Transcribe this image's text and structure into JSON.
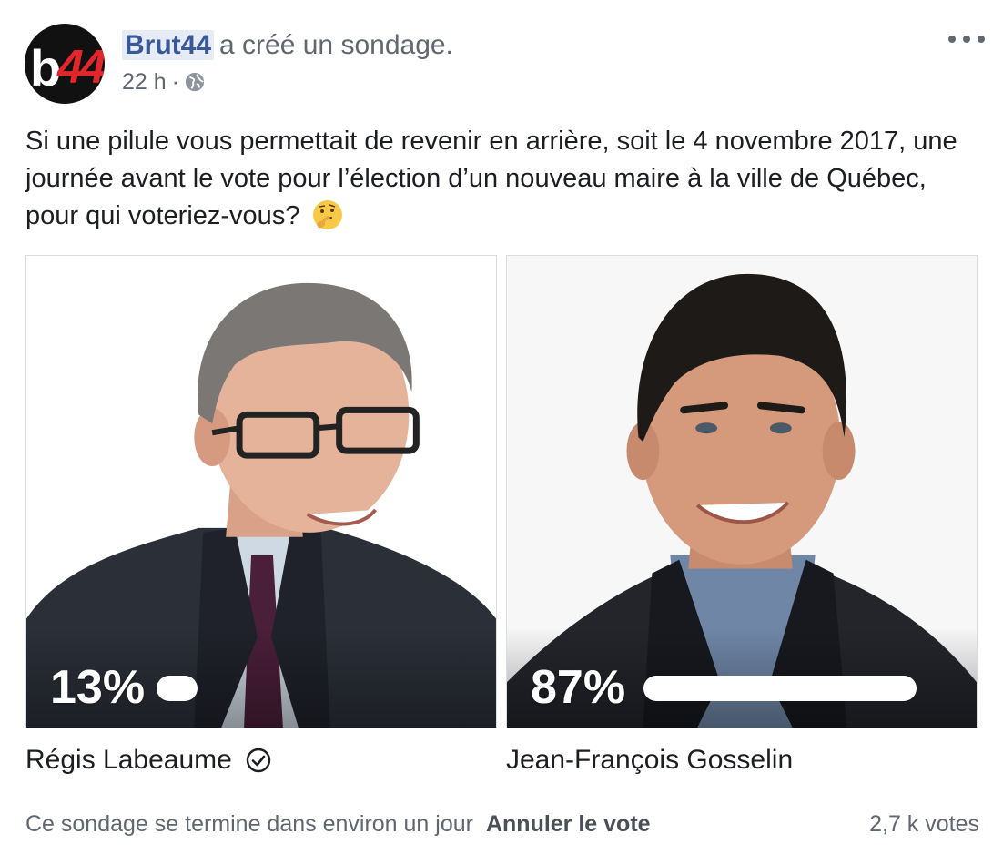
{
  "post": {
    "author": "Brut44",
    "action": "a créé un sondage.",
    "time": "22 h",
    "separator": "·",
    "audience_icon": "globe-icon",
    "avatar_text_b": "b",
    "avatar_text_n": "44",
    "text": "Si une pilule vous permettait de revenir en arrière, soit le 4 novembre 2017, une journée avant le vote pour l’élection d’un nouveau maire à la ville de Québec, pour qui voteriez-vous?",
    "emoji": "thinking-face-emoji"
  },
  "poll": {
    "options": [
      {
        "name": "Régis Labeaume",
        "percent": "13%",
        "share": 0.13,
        "voted": true,
        "check_icon": "checkmark-circle-icon"
      },
      {
        "name": "Jean-François Gosselin",
        "percent": "87%",
        "share": 0.87,
        "voted": false
      }
    ],
    "footer_text": "Ce sondage se termine dans environ un jour",
    "cancel_label": "Annuler le vote",
    "votes": "2,7 k votes"
  },
  "colors": {
    "author": "#385898",
    "author_highlight": "#e7ebf5",
    "secondary_text": "#616770",
    "border": "#dadde1",
    "brand_red": "#e3262b"
  }
}
